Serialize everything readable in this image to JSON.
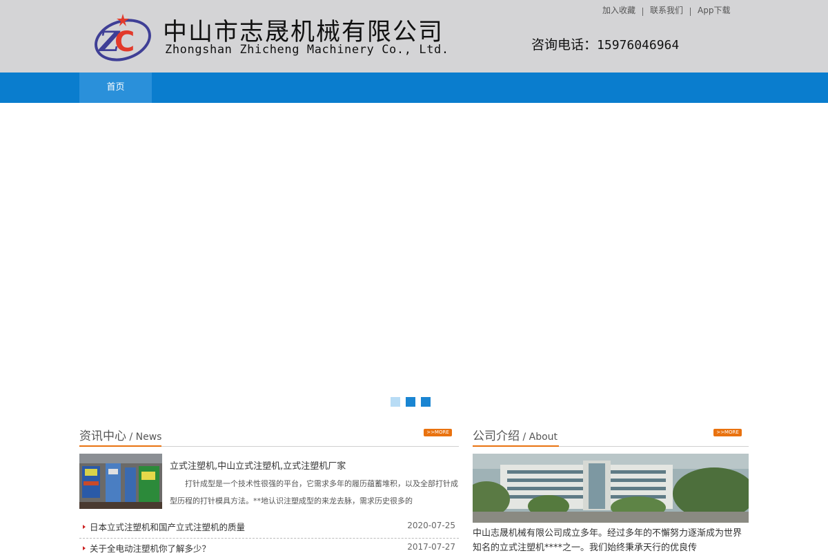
{
  "header": {
    "company_cn": "中山市志晟机械有限公司",
    "company_en": "Zhongshan Zhicheng Machinery Co., Ltd.",
    "phone_label": "咨询电话：",
    "phone_number": "15976046964",
    "links": [
      "加入收藏",
      "联系我们",
      "App下载"
    ]
  },
  "nav": {
    "home": "首页"
  },
  "news": {
    "title_cn": "资讯中心",
    "title_en": " / News",
    "more": ">>MORE",
    "featured_title": "立式注塑机,中山立式注塑机,立式注塑机厂家",
    "featured_summary": "打针成型是一个技术性很强的平台，它需求多年的履历蕴蓄堆积，以及全部打针成型历程的打针模具方法。**地认识注塑成型的来龙去脉，需求历史很多的",
    "items": [
      {
        "title": "日本立式注塑机和国产立式注塑机的质量",
        "date": "2020-07-25"
      },
      {
        "title": "关于全电动注塑机你了解多少？",
        "date": "2017-07-27"
      }
    ]
  },
  "about": {
    "title_cn": "公司介绍",
    "title_en": " / About",
    "more": ">>MORE",
    "text": "中山志晟机械有限公司成立多年。经过多年的不懈努力逐渐成为世界知名的立式注塑机****之一。我们始终秉承天行的优良传"
  },
  "colors": {
    "header_bg": "#d4d4d6",
    "nav_bg": "#0a7dce",
    "nav_active": "#2a90da",
    "accent_orange": "#e9720f",
    "dot_inactive": "#b8dcf5",
    "dot_active": "#1a85d2"
  },
  "slider": {
    "count": 3,
    "active_index": 0
  }
}
